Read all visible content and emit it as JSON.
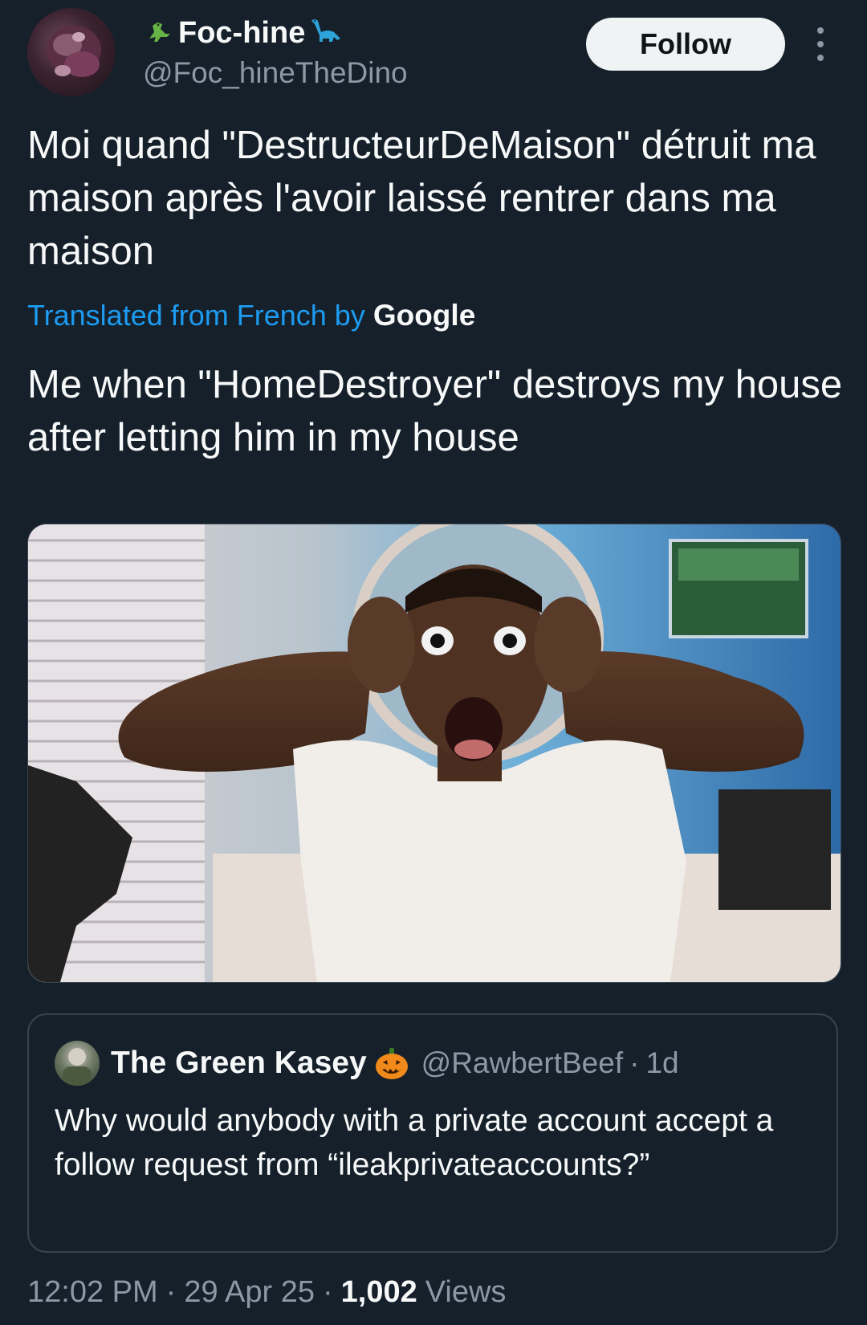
{
  "header": {
    "display_name": "Foc-hine",
    "handle": "@Foc_hineTheDino",
    "follow_label": "Follow",
    "name_left_icon": "t-rex-emoji-icon",
    "name_right_icon": "sauropod-emoji-icon"
  },
  "tweet": {
    "text": "Moi quand \"DestructeurDeMaison\" détruit ma maison après l'avoir laissé rentrer dans ma maison",
    "translate_label": "Translated from French by",
    "translate_provider": "Google",
    "translated_text": "Me when \"HomeDestroyer\" destroys my house after letting him in my house"
  },
  "media": {
    "icon": "photo-shocked-man-hands-on-head"
  },
  "quote": {
    "name": "The Green Kasey",
    "name_icon": "jack-o-lantern-icon",
    "handle": "@RawbertBeef",
    "separator": "·",
    "time": "1d",
    "text": "Why would anybody with a private account accept a follow request from “ileakprivateaccounts?”"
  },
  "meta": {
    "time": "12:02 PM",
    "date": "29 Apr 25",
    "separator": "·",
    "views_count": "1,002",
    "views_label": "Views"
  },
  "colors": {
    "background": "#15202b",
    "text_primary": "#f7f9f9",
    "text_secondary": "#8b98a5",
    "link": "#1d9bf0",
    "border": "#38444d",
    "follow_bg": "#eff3f4"
  }
}
